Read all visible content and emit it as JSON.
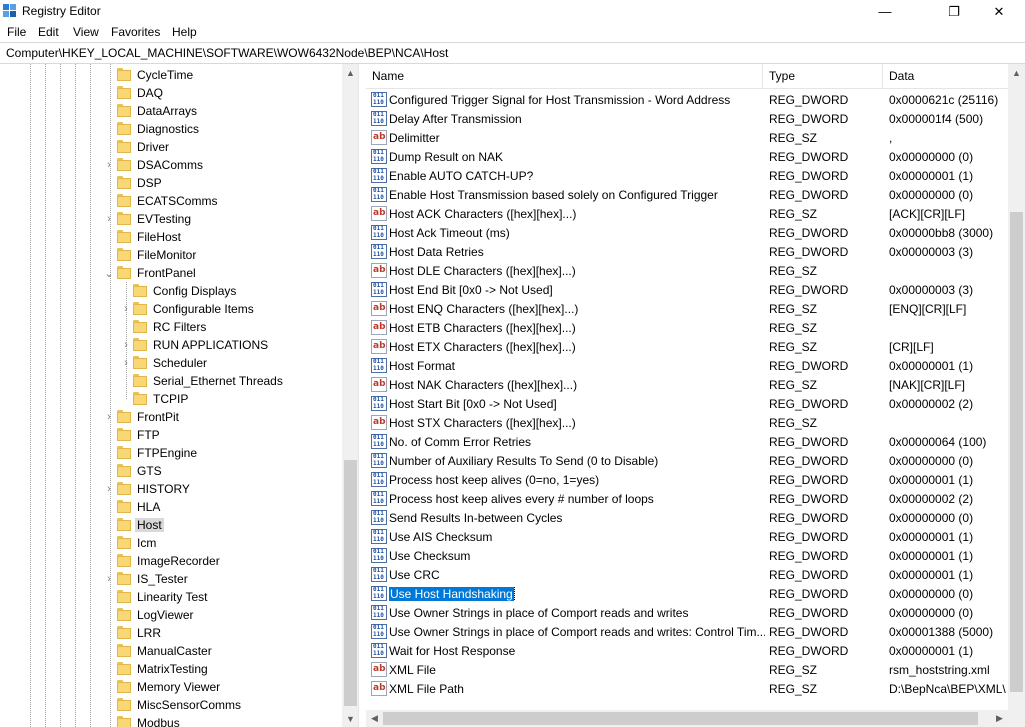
{
  "window": {
    "title": "Registry Editor",
    "minimize_glyph": "—",
    "maximize_glyph": "❐",
    "close_glyph": "✕"
  },
  "menu": [
    "File",
    "Edit",
    "View",
    "Favorites",
    "Help"
  ],
  "address": "Computer\\HKEY_LOCAL_MACHINE\\SOFTWARE\\WOW6432Node\\BEP\\NCA\\Host",
  "tree": {
    "items": [
      {
        "label": "CycleTime",
        "expander": ""
      },
      {
        "label": "DAQ",
        "expander": ""
      },
      {
        "label": "DataArrays",
        "expander": ""
      },
      {
        "label": "Diagnostics",
        "expander": ""
      },
      {
        "label": "Driver",
        "expander": ""
      },
      {
        "label": "DSAComms",
        "expander": ">"
      },
      {
        "label": "DSP",
        "expander": ""
      },
      {
        "label": "ECATSComms",
        "expander": ""
      },
      {
        "label": "EVTesting",
        "expander": ">"
      },
      {
        "label": "FileHost",
        "expander": ""
      },
      {
        "label": "FileMonitor",
        "expander": ""
      },
      {
        "label": "FrontPanel",
        "expander": "v"
      },
      {
        "label": "Config Displays",
        "expander": "",
        "child": true
      },
      {
        "label": "Configurable Items",
        "expander": ">",
        "child": true
      },
      {
        "label": "RC Filters",
        "expander": "",
        "child": true
      },
      {
        "label": "RUN APPLICATIONS",
        "expander": ">",
        "child": true
      },
      {
        "label": "Scheduler",
        "expander": ">",
        "child": true
      },
      {
        "label": "Serial_Ethernet Threads",
        "expander": "",
        "child": true
      },
      {
        "label": "TCPIP",
        "expander": "",
        "child": true
      },
      {
        "label": "FrontPit",
        "expander": ">"
      },
      {
        "label": "FTP",
        "expander": ""
      },
      {
        "label": "FTPEngine",
        "expander": ""
      },
      {
        "label": "GTS",
        "expander": ""
      },
      {
        "label": "HISTORY",
        "expander": ">"
      },
      {
        "label": "HLA",
        "expander": ""
      },
      {
        "label": "Host",
        "expander": "",
        "selected": true
      },
      {
        "label": "Icm",
        "expander": ""
      },
      {
        "label": "ImageRecorder",
        "expander": ""
      },
      {
        "label": "IS_Tester",
        "expander": ">"
      },
      {
        "label": "Linearity Test",
        "expander": ""
      },
      {
        "label": "LogViewer",
        "expander": ""
      },
      {
        "label": "LRR",
        "expander": ""
      },
      {
        "label": "ManualCaster",
        "expander": ""
      },
      {
        "label": "MatrixTesting",
        "expander": ""
      },
      {
        "label": "Memory Viewer",
        "expander": ""
      },
      {
        "label": "MiscSensorComms",
        "expander": ""
      },
      {
        "label": "Modbus",
        "expander": ""
      }
    ]
  },
  "list": {
    "columns": {
      "name": "Name",
      "type": "Type",
      "data": "Data"
    },
    "rows": [
      {
        "name": "Configured Trigger Signal for Host Transmission - Word Address",
        "type": "REG_DWORD",
        "data": "0x0000621c (25116)"
      },
      {
        "name": "Delay After Transmission",
        "type": "REG_DWORD",
        "data": "0x000001f4 (500)"
      },
      {
        "name": "Delimitter",
        "type": "REG_SZ",
        "data": ","
      },
      {
        "name": "Dump Result on NAK",
        "type": "REG_DWORD",
        "data": "0x00000000 (0)"
      },
      {
        "name": "Enable AUTO CATCH-UP?",
        "type": "REG_DWORD",
        "data": "0x00000001 (1)"
      },
      {
        "name": "Enable Host Transmission based solely on Configured Trigger",
        "type": "REG_DWORD",
        "data": "0x00000000 (0)"
      },
      {
        "name": "Host ACK Characters ([hex][hex]...)",
        "type": "REG_SZ",
        "data": "[ACK][CR][LF]"
      },
      {
        "name": "Host Ack Timeout (ms)",
        "type": "REG_DWORD",
        "data": "0x00000bb8 (3000)"
      },
      {
        "name": "Host Data Retries",
        "type": "REG_DWORD",
        "data": "0x00000003 (3)"
      },
      {
        "name": "Host DLE Characters ([hex][hex]...)",
        "type": "REG_SZ",
        "data": ""
      },
      {
        "name": "Host End Bit [0x0 -> Not Used]",
        "type": "REG_DWORD",
        "data": "0x00000003 (3)"
      },
      {
        "name": "Host ENQ Characters ([hex][hex]...)",
        "type": "REG_SZ",
        "data": "[ENQ][CR][LF]"
      },
      {
        "name": "Host ETB Characters ([hex][hex]...)",
        "type": "REG_SZ",
        "data": ""
      },
      {
        "name": "Host ETX Characters ([hex][hex]...)",
        "type": "REG_SZ",
        "data": "[CR][LF]"
      },
      {
        "name": "Host Format",
        "type": "REG_DWORD",
        "data": "0x00000001 (1)"
      },
      {
        "name": "Host NAK Characters ([hex][hex]...)",
        "type": "REG_SZ",
        "data": "[NAK][CR][LF]"
      },
      {
        "name": "Host Start Bit [0x0 -> Not Used]",
        "type": "REG_DWORD",
        "data": "0x00000002 (2)"
      },
      {
        "name": "Host STX Characters ([hex][hex]...)",
        "type": "REG_SZ",
        "data": ""
      },
      {
        "name": "No. of Comm Error Retries",
        "type": "REG_DWORD",
        "data": "0x00000064 (100)"
      },
      {
        "name": "Number of Auxiliary Results To Send (0 to Disable)",
        "type": "REG_DWORD",
        "data": "0x00000000 (0)"
      },
      {
        "name": "Process host keep alives (0=no, 1=yes)",
        "type": "REG_DWORD",
        "data": "0x00000001 (1)"
      },
      {
        "name": "Process host keep alives every # number of loops",
        "type": "REG_DWORD",
        "data": "0x00000002 (2)"
      },
      {
        "name": "Send Results In-between Cycles",
        "type": "REG_DWORD",
        "data": "0x00000000 (0)"
      },
      {
        "name": "Use AIS Checksum",
        "type": "REG_DWORD",
        "data": "0x00000001 (1)"
      },
      {
        "name": "Use Checksum",
        "type": "REG_DWORD",
        "data": "0x00000001 (1)"
      },
      {
        "name": "Use CRC",
        "type": "REG_DWORD",
        "data": "0x00000001 (1)"
      },
      {
        "name": "Use Host Handshaking",
        "type": "REG_DWORD",
        "data": "0x00000000 (0)",
        "selected": true
      },
      {
        "name": "Use Owner Strings in place of Comport reads and writes",
        "type": "REG_DWORD",
        "data": "0x00000000 (0)"
      },
      {
        "name": "Use Owner Strings in place of Comport reads and writes: Control Tim...",
        "type": "REG_DWORD",
        "data": "0x00001388 (5000)"
      },
      {
        "name": "Wait for Host Response",
        "type": "REG_DWORD",
        "data": "0x00000001 (1)"
      },
      {
        "name": "XML File",
        "type": "REG_SZ",
        "data": "rsm_hoststring.xml"
      },
      {
        "name": "XML File Path",
        "type": "REG_SZ",
        "data": "D:\\BepNca\\BEP\\XML\\"
      }
    ]
  }
}
